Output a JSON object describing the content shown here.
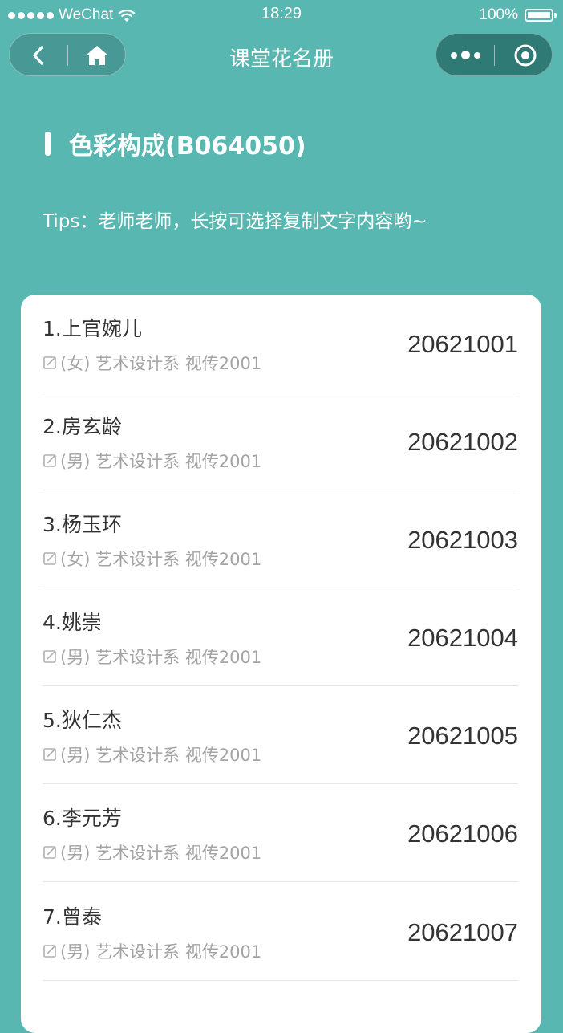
{
  "status_bar": {
    "carrier": "WeChat",
    "time": "18:29",
    "battery": "100%"
  },
  "nav": {
    "title": "课堂花名册"
  },
  "course": {
    "name": "色彩构成(B064050)"
  },
  "tips": "Tips：老师老师，长按可选择复制文字内容哟~",
  "students": [
    {
      "name": "1.上官婉儿",
      "info": "(女) 艺术设计系 视传2001",
      "id": "20621001"
    },
    {
      "name": "2.房玄龄",
      "info": "(男) 艺术设计系 视传2001",
      "id": "20621002"
    },
    {
      "name": "3.杨玉环",
      "info": "(女) 艺术设计系 视传2001",
      "id": "20621003"
    },
    {
      "name": "4.姚崇",
      "info": "(男) 艺术设计系 视传2001",
      "id": "20621004"
    },
    {
      "name": "5.狄仁杰",
      "info": "(男) 艺术设计系 视传2001",
      "id": "20621005"
    },
    {
      "name": "6.李元芳",
      "info": "(男) 艺术设计系 视传2001",
      "id": "20621006"
    },
    {
      "name": "7.曾泰",
      "info": "(男) 艺术设计系 视传2001",
      "id": "20621007"
    }
  ],
  "icons": {
    "signal": "signal-dots-icon",
    "wifi": "wifi-icon",
    "battery": "battery-icon",
    "back": "back-arrow-icon",
    "home": "home-icon",
    "more": "more-dots-icon",
    "close": "target-circle-icon",
    "edit": "edit-note-icon"
  },
  "colors": {
    "background": "#58b7b1",
    "card": "#ffffff",
    "text": "#333333",
    "muted": "#a4a4a4"
  }
}
